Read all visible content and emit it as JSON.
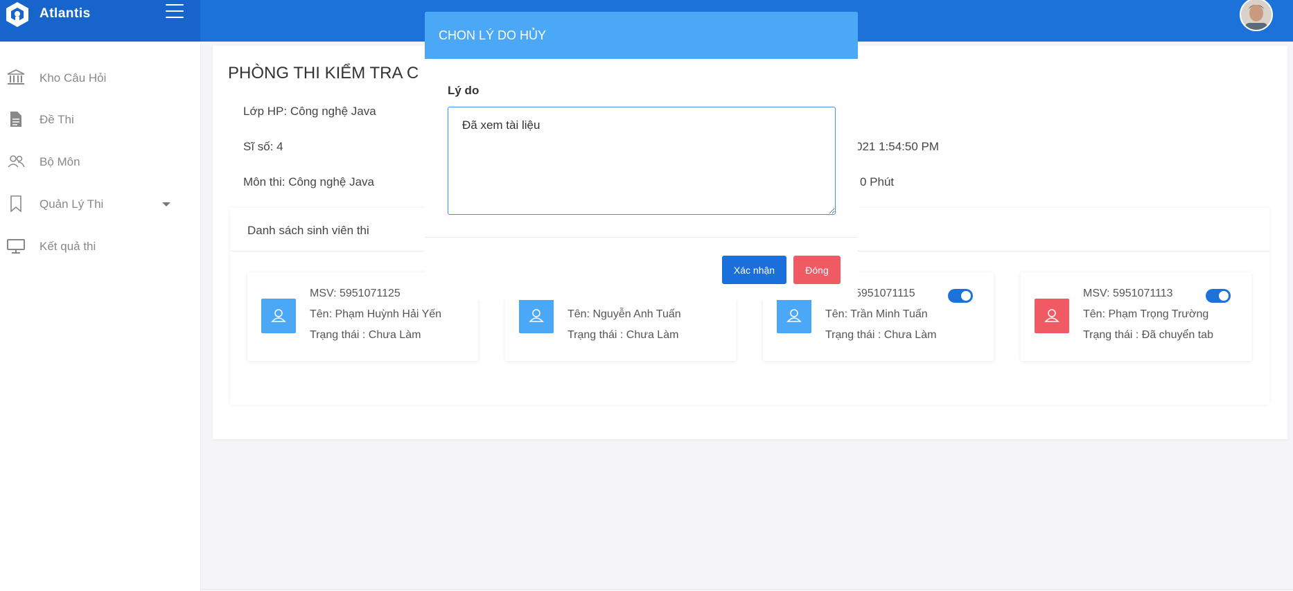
{
  "app": {
    "brand": "Atlantis"
  },
  "sidebar": {
    "items": [
      {
        "label": "Kho Câu Hỏi",
        "icon": "bank-icon"
      },
      {
        "label": "Đề Thi",
        "icon": "document-icon"
      },
      {
        "label": "Bộ Môn",
        "icon": "users-icon"
      },
      {
        "label": "Quản Lý Thi",
        "icon": "bookmark-icon",
        "has_submenu": true
      },
      {
        "label": "Kết quả thi",
        "icon": "monitor-icon"
      }
    ]
  },
  "page": {
    "title": "PHÒNG THI KIỂM TRA C",
    "class": "Lớp HP: Công nghệ Java",
    "count": "Sĩ số: 4",
    "subject": "Môn thi: Công nghệ Java",
    "time_fragment": "021 1:54:50 PM",
    "duration_fragment": "0 Phút"
  },
  "student_list": {
    "title": "Danh sách sinh viên thi",
    "students": [
      {
        "msv": "MSV: 5951071125",
        "name": "Tên: Phạm Huỳnh Hải Yến",
        "status": "Trạng thái : Chưa Làm",
        "icon_color": "#4aa8f6"
      },
      {
        "msv": "",
        "name": "Tên: Nguyễn Anh Tuấn",
        "status": "Trạng thái : Chưa Làm",
        "icon_color": "#4aa8f6"
      },
      {
        "msv": "5951071115",
        "name": "Tên: Trần Minh Tuấn",
        "status": "Trạng thái : Chưa Làm",
        "icon_color": "#4aa8f6"
      },
      {
        "msv": "MSV: 5951071113",
        "name": "Tên: Phạm Trọng Trường",
        "status": "Trạng thái : Đã chuyển tab",
        "icon_color": "#f05a63"
      }
    ]
  },
  "modal": {
    "title": "CHON LÝ DO HỦY",
    "field_label": "Lý do",
    "reason_value": "Đã xem tài liệu",
    "confirm_label": "Xác nhận",
    "close_label": "Đóng"
  },
  "colors": {
    "primary": "#1d72d9",
    "modal_header": "#4aa8f6",
    "danger": "#f05a63"
  }
}
